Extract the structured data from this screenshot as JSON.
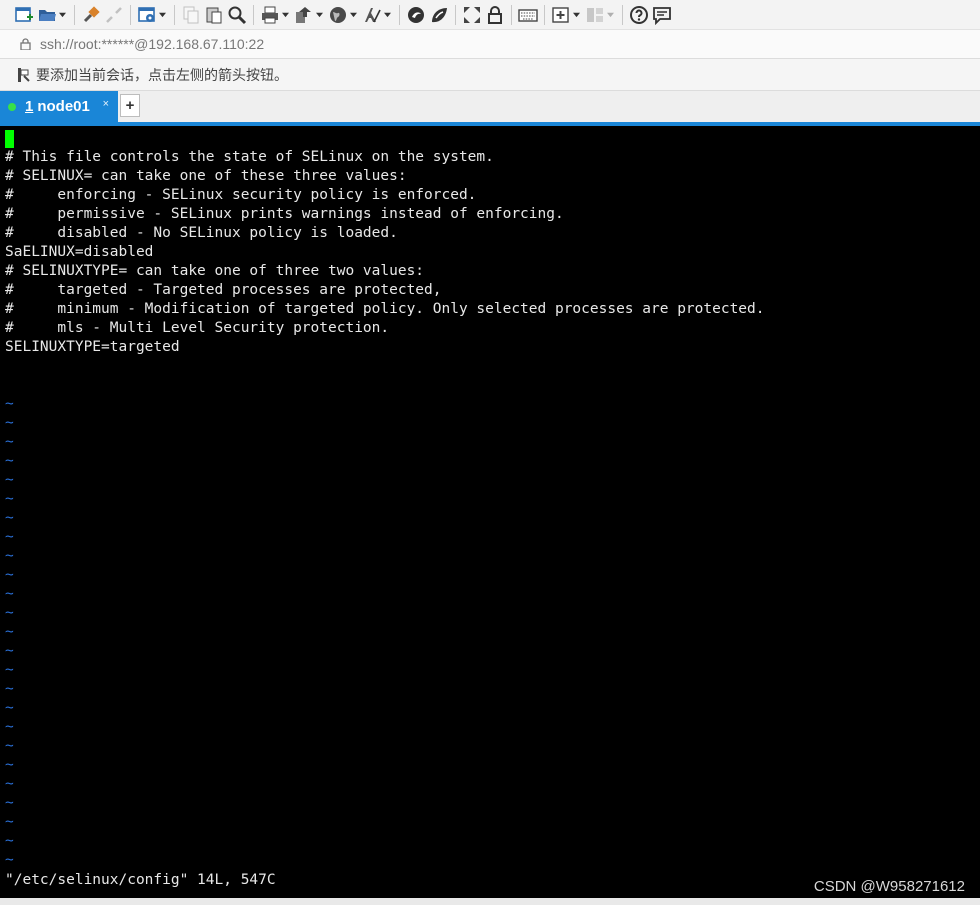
{
  "toolbar": {
    "icons": [
      "new-session-icon",
      "open-folder-icon",
      "connect-icon",
      "disconnect-icon",
      "properties-icon",
      "copy-icon",
      "paste-icon",
      "find-icon",
      "print-icon",
      "transfer-icon",
      "globe-icon",
      "font-icon",
      "xftp-icon",
      "xshell-icon",
      "fullscreen-icon",
      "lock-icon",
      "keyboard-icon",
      "compose-icon",
      "layout-icon",
      "help-icon",
      "chat-icon"
    ]
  },
  "address": {
    "text": "ssh://root:******@192.168.67.110:22"
  },
  "hint": {
    "text": "要添加当前会话，点击左侧的箭头按钮。"
  },
  "tabs": [
    {
      "number": "1",
      "name": "node01",
      "close": "×",
      "active": true
    }
  ],
  "new_tab": "+",
  "terminal": {
    "lines": [
      "# This file controls the state of SELinux on the system.",
      "# SELINUX= can take one of these three values:",
      "#     enforcing - SELinux security policy is enforced.",
      "#     permissive - SELinux prints warnings instead of enforcing.",
      "#     disabled - No SELinux policy is loaded.",
      "SaELINUX=disabled",
      "# SELINUXTYPE= can take one of three two values:",
      "#     targeted - Targeted processes are protected,",
      "#     minimum - Modification of targeted policy. Only selected processes are protected.",
      "#     mls - Multi Level Security protection.",
      "SELINUXTYPE=targeted"
    ],
    "tilde": "~",
    "tilde_count": 25,
    "status": "\"/etc/selinux/config\" 14L, 547C"
  },
  "watermark": "CSDN @W958271612",
  "colors": {
    "accent": "#1a86d7",
    "cursor": "#00ff00",
    "tilde": "#2a6fd6",
    "terminal_bg": "#000000"
  }
}
